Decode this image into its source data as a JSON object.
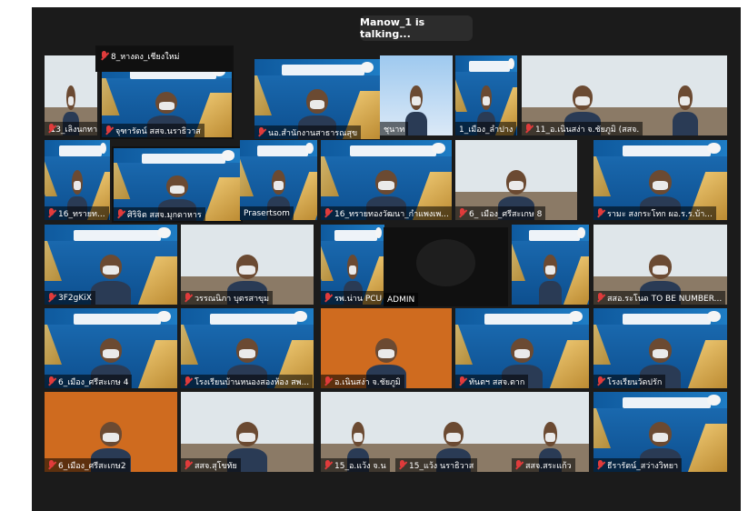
{
  "banner": {
    "talking": "Manow_1 is talking..."
  },
  "colors": {
    "app_bg": "#1b1b1b",
    "mute": "#e03b3b",
    "tile_blue": "#0d4f8f"
  },
  "tiles": [
    {
      "name": "13_เลิงนกทา",
      "muted": true
    },
    {
      "name": "จุฑารัตน์ สสจ.นราธิวาส",
      "muted": true
    },
    {
      "name": "นอ.สำนักงานสาธารณสุข",
      "muted": true
    },
    {
      "name": "ชุนาท",
      "muted": false
    },
    {
      "name": "1_เมือง_ลำปาง",
      "muted": false
    },
    {
      "name": "11_อ.เนินสง่า จ.ชัยภูมิ (สสจ.",
      "muted": true
    },
    {
      "name": "",
      "muted": false
    },
    {
      "name": "16_ทรายท...",
      "muted": true
    },
    {
      "name": "ศิริจิต สสจ.มุกดาหาร",
      "muted": true
    },
    {
      "name": "Prasertsom",
      "muted": false
    },
    {
      "name": "16_ทรายทองวัฒนา_กำแพงเพ...",
      "muted": true
    },
    {
      "name": "6_ เมือง_ศรีสะเกษ 8",
      "muted": true
    },
    {
      "name": "รามะ สงกระโทก ผอ.ร.ร.บ้า...",
      "muted": true
    },
    {
      "name": "3F2gKiX",
      "muted": true
    },
    {
      "name": "วรรณนิภา บุตรสาขุม",
      "muted": true
    },
    {
      "name": "รพ.น่าน PCU",
      "muted": true
    },
    {
      "name": "ADMIN",
      "muted": false
    },
    {
      "name": "",
      "muted": false
    },
    {
      "name": "สสอ.ระโนด TO BE NUMBER...",
      "muted": true
    },
    {
      "name": "6_เมือง_ศรีสะเกษ 4",
      "muted": true
    },
    {
      "name": "โรงเรียนบ้านหนองสองห้อง สพ...",
      "muted": true
    },
    {
      "name": "อ.เนินสง่า จ.ชัยภูมิ",
      "muted": true
    },
    {
      "name": "ทันตฯ สสจ.ตาก",
      "muted": true
    },
    {
      "name": "โรงเรียนวัดปรัก",
      "muted": true
    },
    {
      "name": "6_เมือง_ศรีสะเกษ2",
      "muted": true
    },
    {
      "name": "สสจ.สุโขทัย",
      "muted": true
    },
    {
      "name": "15_อ.แว้ง จ.น",
      "muted": true
    },
    {
      "name": "15_แว้ง นราธิวาส",
      "muted": true
    },
    {
      "name": "สสจ.สระแก้ว",
      "muted": true
    },
    {
      "name": "ธีรารัตน์_สว่างวิทยา",
      "muted": true
    },
    {
      "name": "8_หางดง_เชียงใหม่",
      "muted": true
    }
  ]
}
